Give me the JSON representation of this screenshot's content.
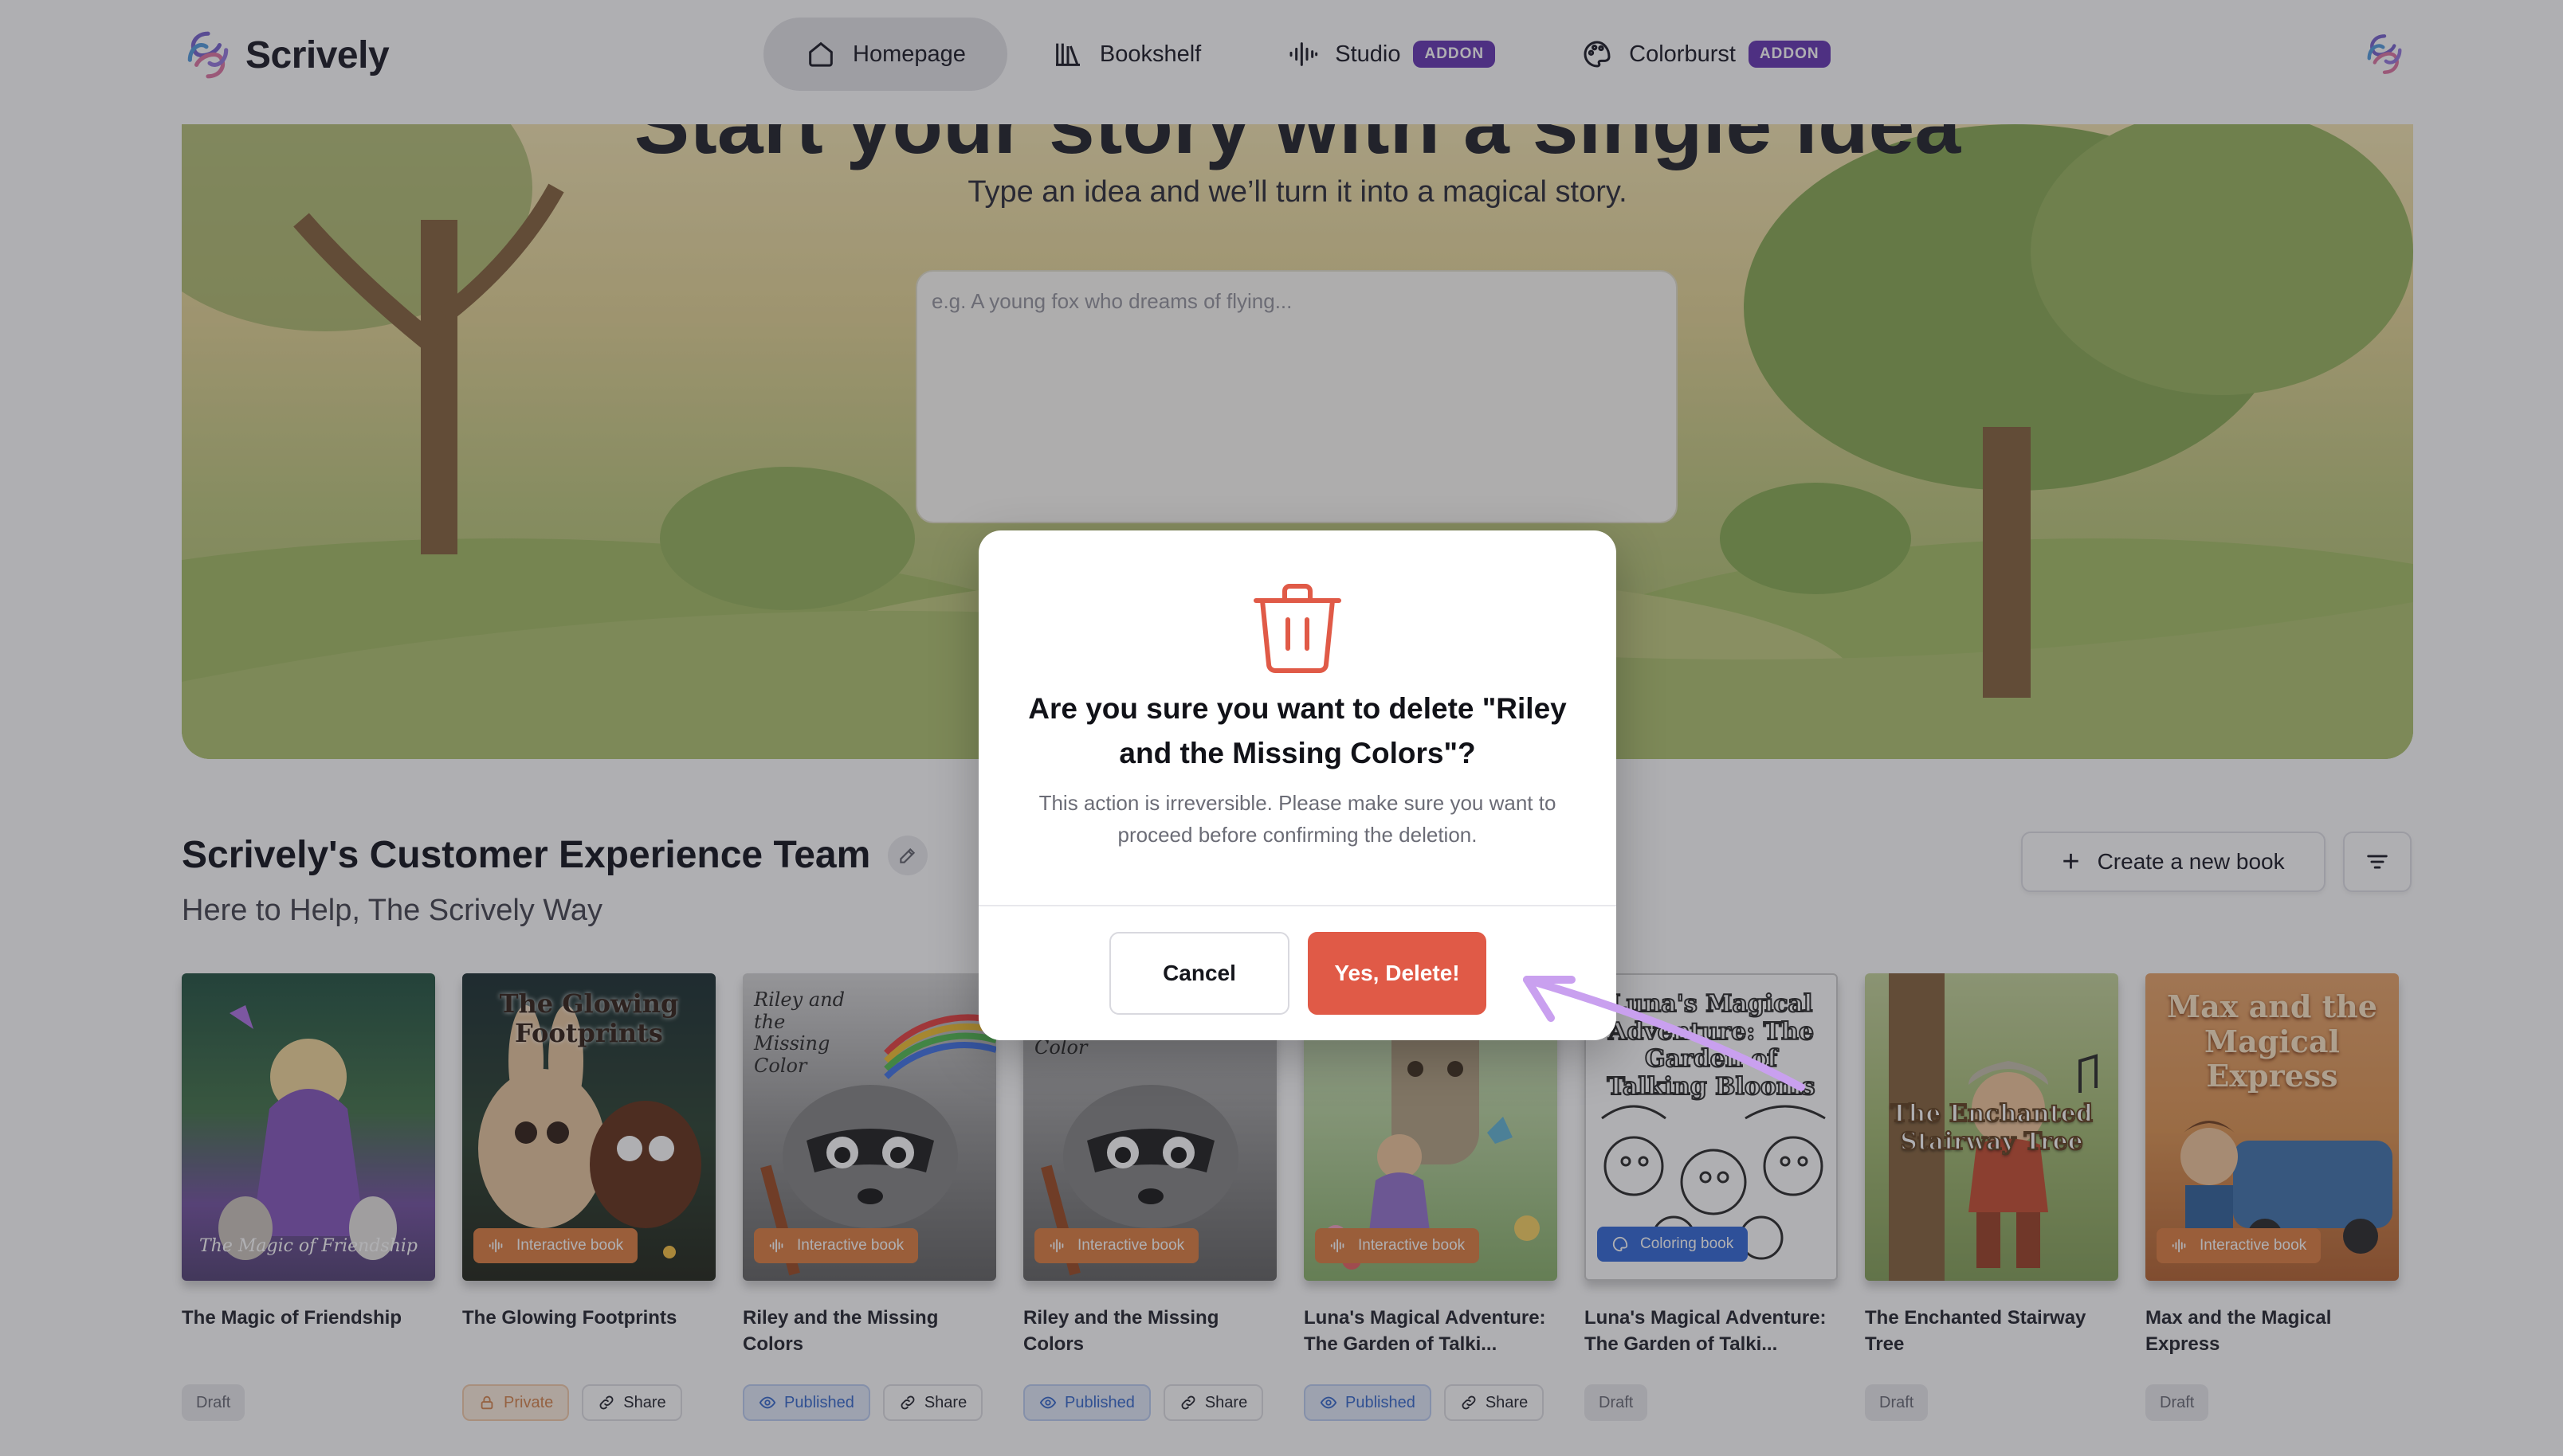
{
  "app": {
    "name": "Scrively"
  },
  "nav": {
    "items": [
      {
        "label": "Homepage",
        "active": true,
        "icon": "home-icon"
      },
      {
        "label": "Bookshelf",
        "active": false,
        "icon": "bookshelf-icon"
      },
      {
        "label": "Studio",
        "active": false,
        "icon": "waveform-icon",
        "badge": "ADDON"
      },
      {
        "label": "Colorburst",
        "active": false,
        "icon": "palette-icon",
        "badge": "ADDON"
      }
    ]
  },
  "hero": {
    "title": "Start your story with a single idea",
    "subtitle": "Type an idea and we’ll turn it into a magical story.",
    "input_placeholder": "e.g. A young fox who dreams of flying..."
  },
  "team": {
    "name": "Scrively's Customer Experience Team",
    "tagline": "Here to Help, The Scrively Way",
    "create_label": "Create a new book"
  },
  "books": [
    {
      "title": "The Magic of Friendship",
      "cover_text": "The Magic of Friendship",
      "badge": "",
      "status": "Draft",
      "share": ""
    },
    {
      "title": "The Glowing Footprints",
      "cover_text": "The Glowing Footprints",
      "badge": "Interactive book",
      "status": "Private",
      "share": "Share"
    },
    {
      "title": "Riley and the Missing Colors",
      "cover_text": "Riley and the Missing Color",
      "badge": "Interactive book",
      "status": "Published",
      "share": "Share"
    },
    {
      "title": "Riley and the Missing Colors",
      "cover_text": "Color",
      "badge": "Interactive book",
      "status": "Published",
      "share": "Share"
    },
    {
      "title": "Luna's Magical Adventure: The Garden of Talki...",
      "cover_text": "",
      "badge": "Interactive book",
      "status": "Published",
      "share": "Share"
    },
    {
      "title": "Luna's Magical Adventure: The Garden of Talki...",
      "cover_text": "Luna's Magical Adventure: The Garden of Talking Blooms",
      "badge": "Coloring book",
      "status": "Draft",
      "share": ""
    },
    {
      "title": "The Enchanted Stairway Tree",
      "cover_text": "The Enchanted Stairway Tree",
      "badge": "",
      "status": "Draft",
      "share": ""
    },
    {
      "title": "Max and the Magical Express",
      "cover_text": "Max and the Magical Express",
      "badge": "Interactive book",
      "status": "Draft",
      "share": ""
    }
  ],
  "modal": {
    "title": "Are you sure you want to delete \"Riley and the Missing Colors\"?",
    "body": "This action is irreversible. Please make sure you want to proceed before confirming the deletion.",
    "cancel_label": "Cancel",
    "confirm_label": "Yes, Delete!"
  },
  "colors": {
    "accent": "#6c3fb7",
    "danger": "#e05a47",
    "orange_badge": "#e0844a",
    "blue_badge": "#3c6fd9"
  }
}
